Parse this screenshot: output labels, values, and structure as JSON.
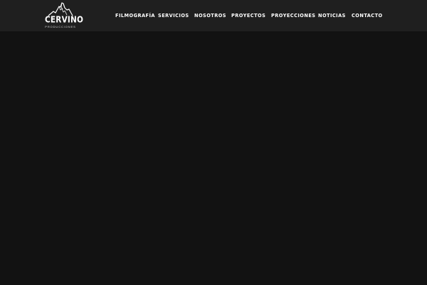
{
  "brand": {
    "name": "CERVINO",
    "tagline": "PRODUCCIONES"
  },
  "nav": {
    "items": [
      {
        "label": "FILMOGRAFÍA"
      },
      {
        "label": "SERVICIOS"
      },
      {
        "label": "NOSOTROS"
      },
      {
        "label": "PROYECTOS"
      },
      {
        "label": "PROYECCIONES"
      },
      {
        "label": "NOTICIAS"
      },
      {
        "label": "CONTACTO"
      }
    ]
  },
  "colors": {
    "header_bg": "#1f1f1f",
    "page_bg": "#121212",
    "nav_text": "#ffffff"
  }
}
